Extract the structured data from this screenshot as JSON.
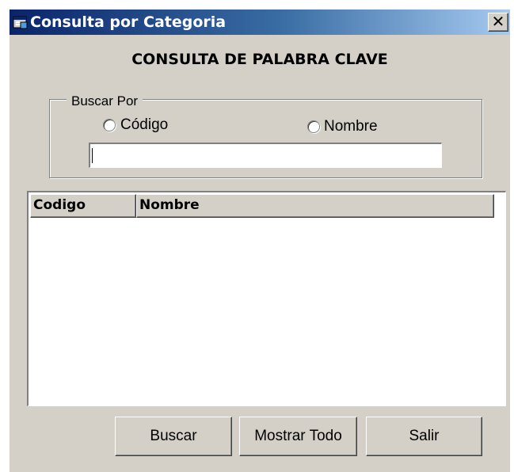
{
  "window": {
    "title": "Consulta por Categoria",
    "title_icon": "app-window-icon",
    "close_glyph": "✕"
  },
  "heading": "CONSULTA DE PALABRA CLAVE",
  "search_group": {
    "legend": "Buscar Por",
    "radio_codigo_label": "Código",
    "radio_nombre_label": "Nombre",
    "search_value": ""
  },
  "table": {
    "columns": [
      "Codigo",
      "Nombre"
    ],
    "rows": []
  },
  "buttons": {
    "buscar": "Buscar",
    "mostrar_todo": "Mostrar Todo",
    "salir": "Salir"
  },
  "colors": {
    "window_face": "#d4d0c8",
    "titlebar_start": "#0a246a",
    "titlebar_end": "#a6caf0"
  }
}
